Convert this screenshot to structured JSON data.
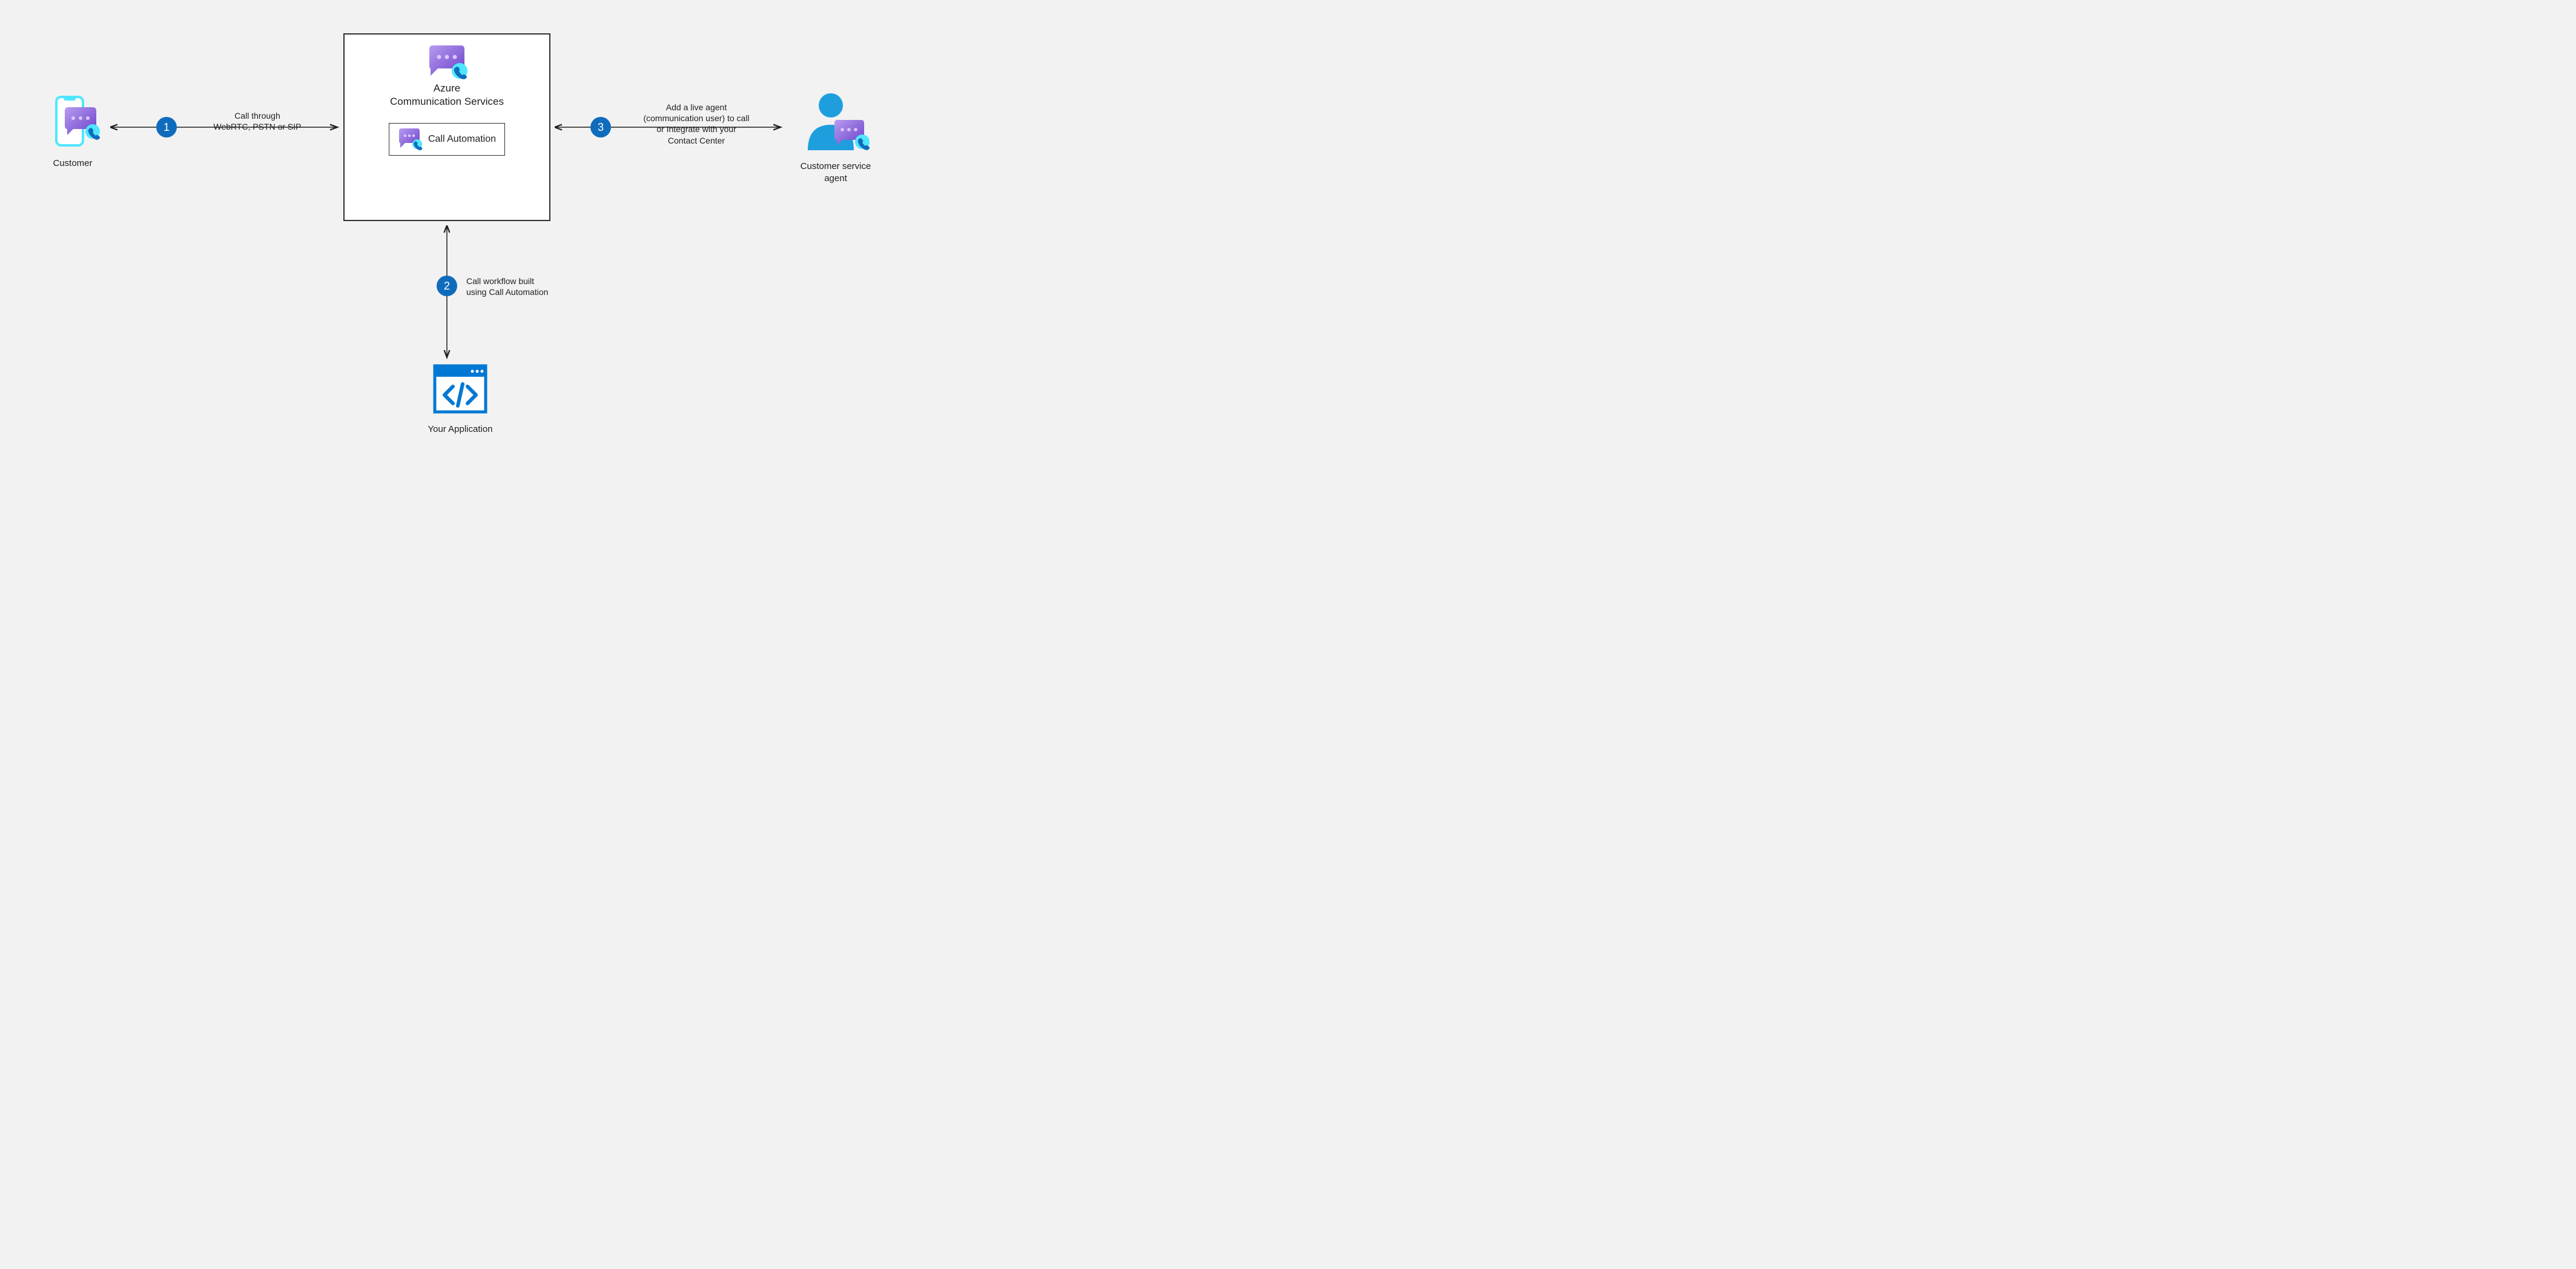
{
  "nodes": {
    "customer": {
      "label": "Customer"
    },
    "acs": {
      "title_line1": "Azure",
      "title_line2": "Communication Services",
      "sub": "Call Automation"
    },
    "app": {
      "label": "Your Application"
    },
    "agent": {
      "label_line1": "Customer service",
      "label_line2": "agent"
    }
  },
  "steps": {
    "s1": {
      "num": "1",
      "label_line1": "Call through",
      "label_line2": "WebRTC, PSTN or SIP"
    },
    "s2": {
      "num": "2",
      "label_line1": "Call workflow built",
      "label_line2": "using Call Automation"
    },
    "s3": {
      "num": "3",
      "label_line1": "Add a live agent",
      "label_line2": "(communication user) to call",
      "label_line3": "or Integrate with your",
      "label_line4": "Contact Center"
    }
  },
  "colors": {
    "accent": "#0f6cbd",
    "purple_light": "#a68fe0",
    "purple_dark": "#7b4ad1",
    "cyan": "#50e6ff",
    "blue": "#0078d4"
  }
}
